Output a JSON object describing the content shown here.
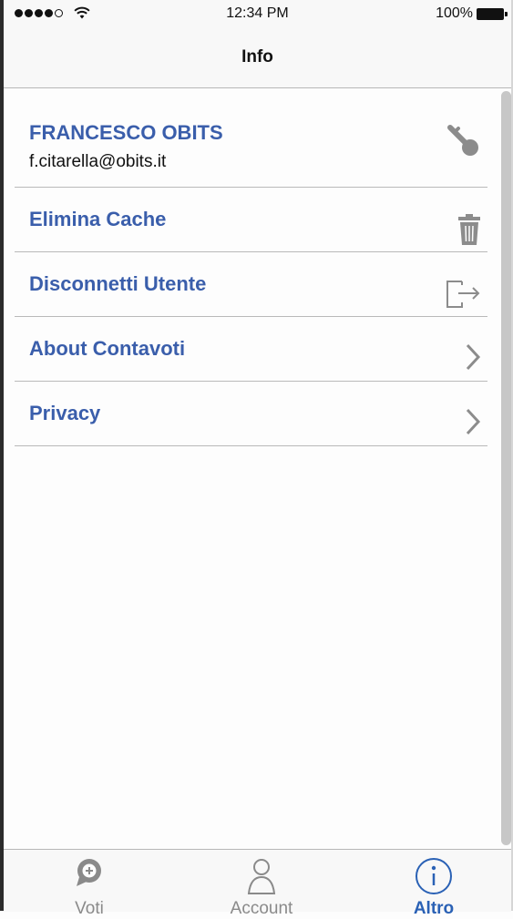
{
  "status_bar": {
    "time": "12:34 PM",
    "battery": "100%"
  },
  "nav": {
    "title": "Info"
  },
  "user": {
    "name": "FRANCESCO OBITS",
    "email": "f.citarella@obits.it"
  },
  "menu": [
    {
      "label": "Elimina Cache",
      "icon": "trash-icon"
    },
    {
      "label": "Disconnetti Utente",
      "icon": "logout-icon"
    },
    {
      "label": "About Contavoti",
      "icon": "chevron-right-icon"
    },
    {
      "label": "Privacy",
      "icon": "chevron-right-icon"
    }
  ],
  "tabs": [
    {
      "label": "Voti",
      "icon": "vote-bubble-icon",
      "active": false
    },
    {
      "label": "Account",
      "icon": "person-icon",
      "active": false
    },
    {
      "label": "Altro",
      "icon": "info-icon",
      "active": true
    }
  ],
  "colors": {
    "accent": "#3a5eab",
    "active_tab": "#2a61b5",
    "inactive": "#8a8a8a"
  }
}
